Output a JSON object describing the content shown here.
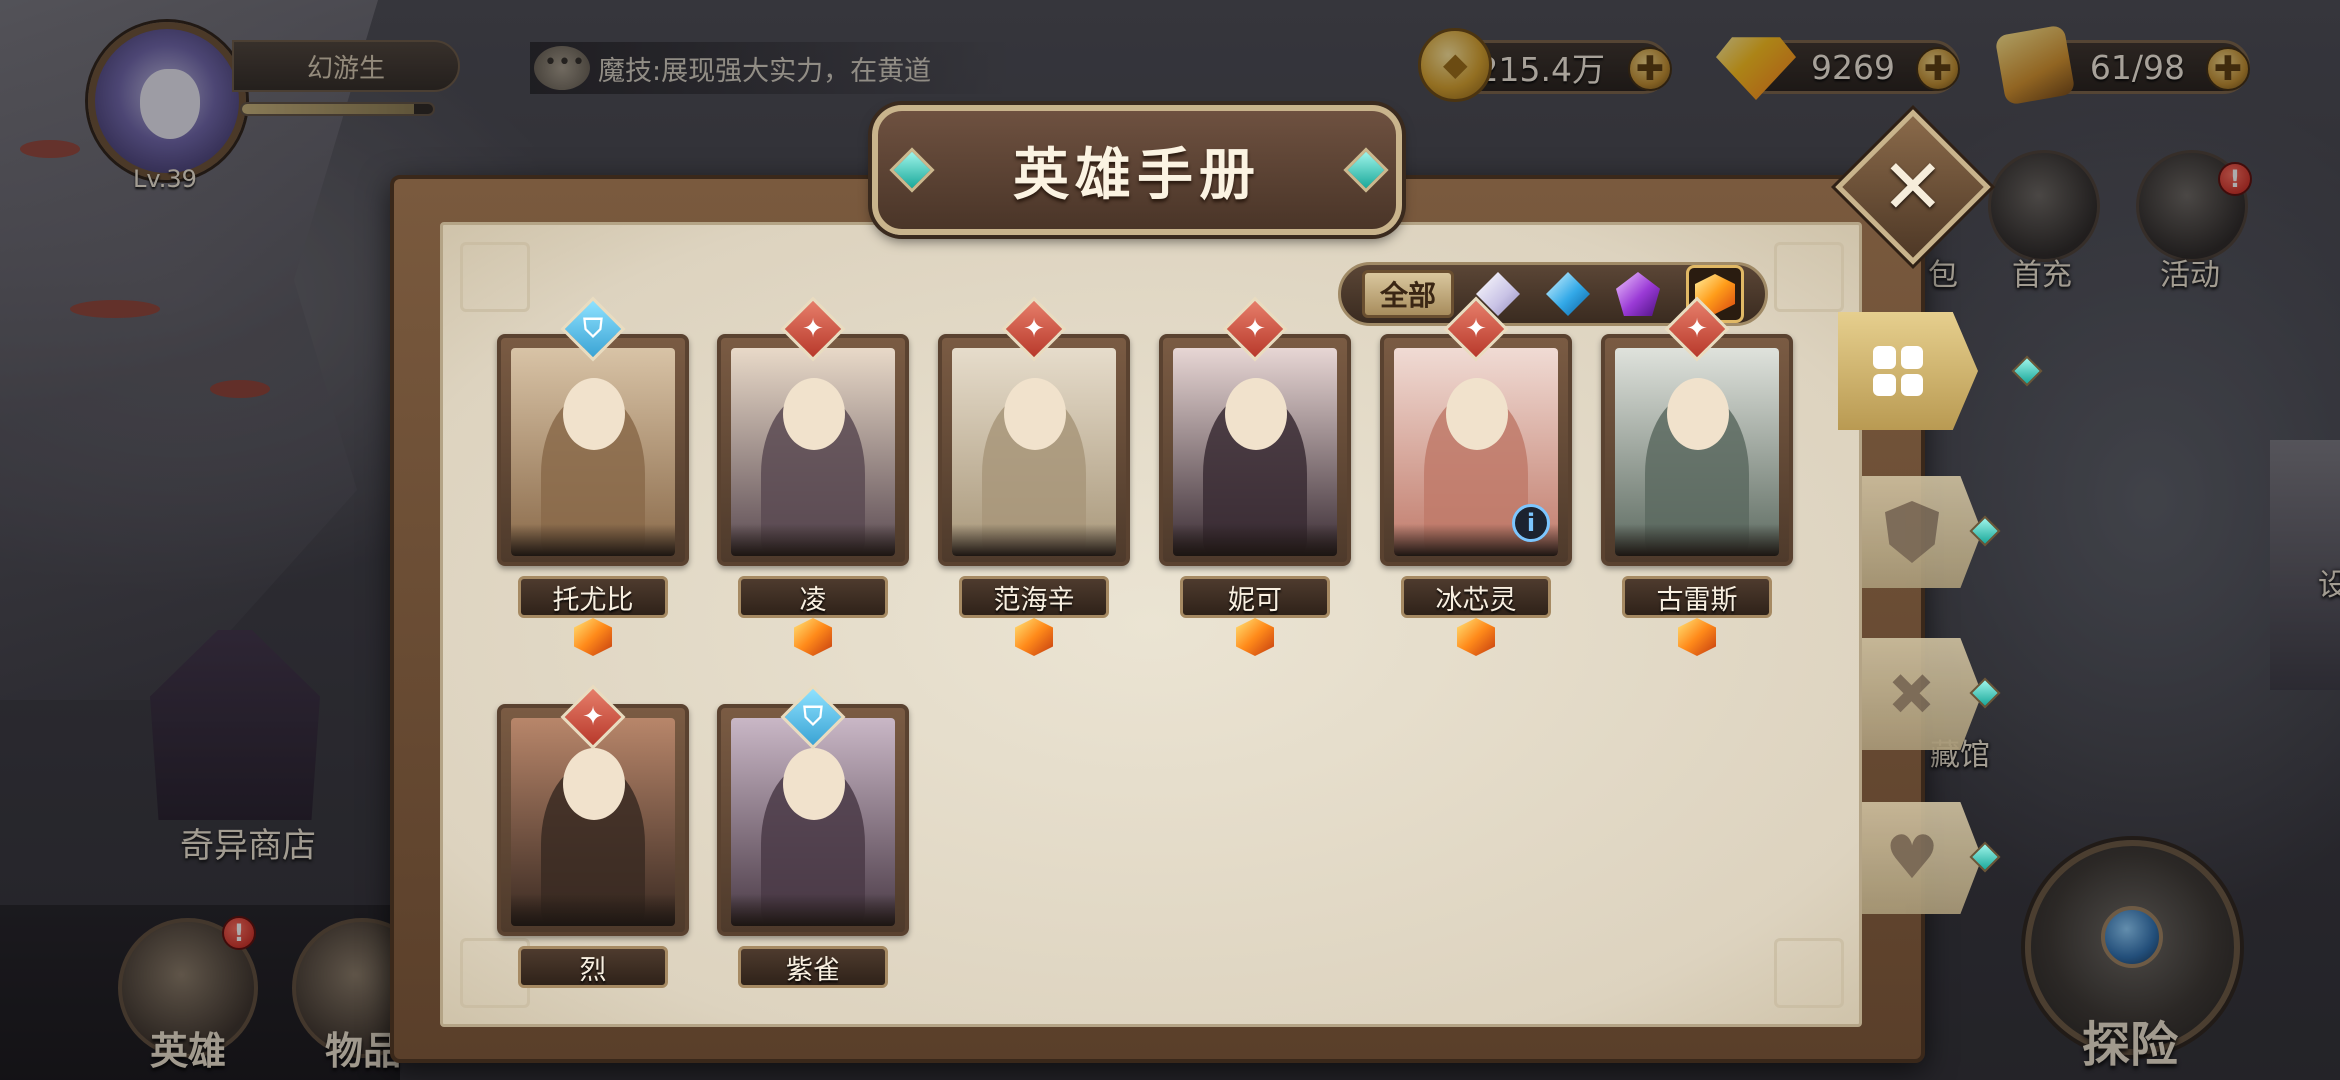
{
  "player": {
    "name": "幻游生",
    "level": "Lv.39",
    "exp_fraction": 0.9
  },
  "chat": {
    "message": "魔技:展现强大实力，在黄道"
  },
  "currencies": {
    "gold": "215.4万",
    "gems": "9269",
    "stamina": "61/98",
    "plus_symbol": "✚"
  },
  "side_menu": {
    "bag_label_partial": "包",
    "first_recharge_label": "首充",
    "events_label": "活动",
    "events_badge": "!",
    "collection_label_partial": "藏馆",
    "edge_label_partial": "设"
  },
  "bottom": {
    "shop_label": "奇异商店",
    "heroes_label": "英雄",
    "heroes_badge": "!",
    "items_label_partial": "物品",
    "explore_label": "探险"
  },
  "modal": {
    "title": "英雄手册",
    "close_symbol": "✕",
    "filter": {
      "all_label": "全部",
      "gems": [
        "white-diamond-icon",
        "blue-diamond-icon",
        "purple-pentagon-icon",
        "orange-hexagon-icon"
      ],
      "selected": "orange-hexagon-icon"
    },
    "heroes": [
      {
        "name": "托尤比",
        "class": "shield",
        "rarity": "orange"
      },
      {
        "name": "凌",
        "class": "sword",
        "rarity": "orange"
      },
      {
        "name": "范海辛",
        "class": "sword",
        "rarity": "orange"
      },
      {
        "name": "妮可",
        "class": "sword",
        "rarity": "orange"
      },
      {
        "name": "冰芯灵",
        "class": "sword",
        "rarity": "orange",
        "info": "i"
      },
      {
        "name": "古雷斯",
        "class": "sword",
        "rarity": "orange"
      },
      {
        "name": "烈",
        "class": "sword",
        "rarity": "none"
      },
      {
        "name": "紫雀",
        "class": "shield",
        "rarity": "none"
      }
    ],
    "tabs": [
      {
        "icon": "grid-icon",
        "active": true
      },
      {
        "icon": "shield-icon",
        "active": false
      },
      {
        "icon": "sword-icon",
        "active": false
      },
      {
        "icon": "heart-icon",
        "active": false
      }
    ]
  },
  "colors": {
    "accent_gold": "#c9b48c",
    "gem_teal": "#1aa89a",
    "rarity_orange": "#ff8a1a",
    "badge_red": "#b8392b",
    "badge_blue": "#3aa3d4"
  }
}
